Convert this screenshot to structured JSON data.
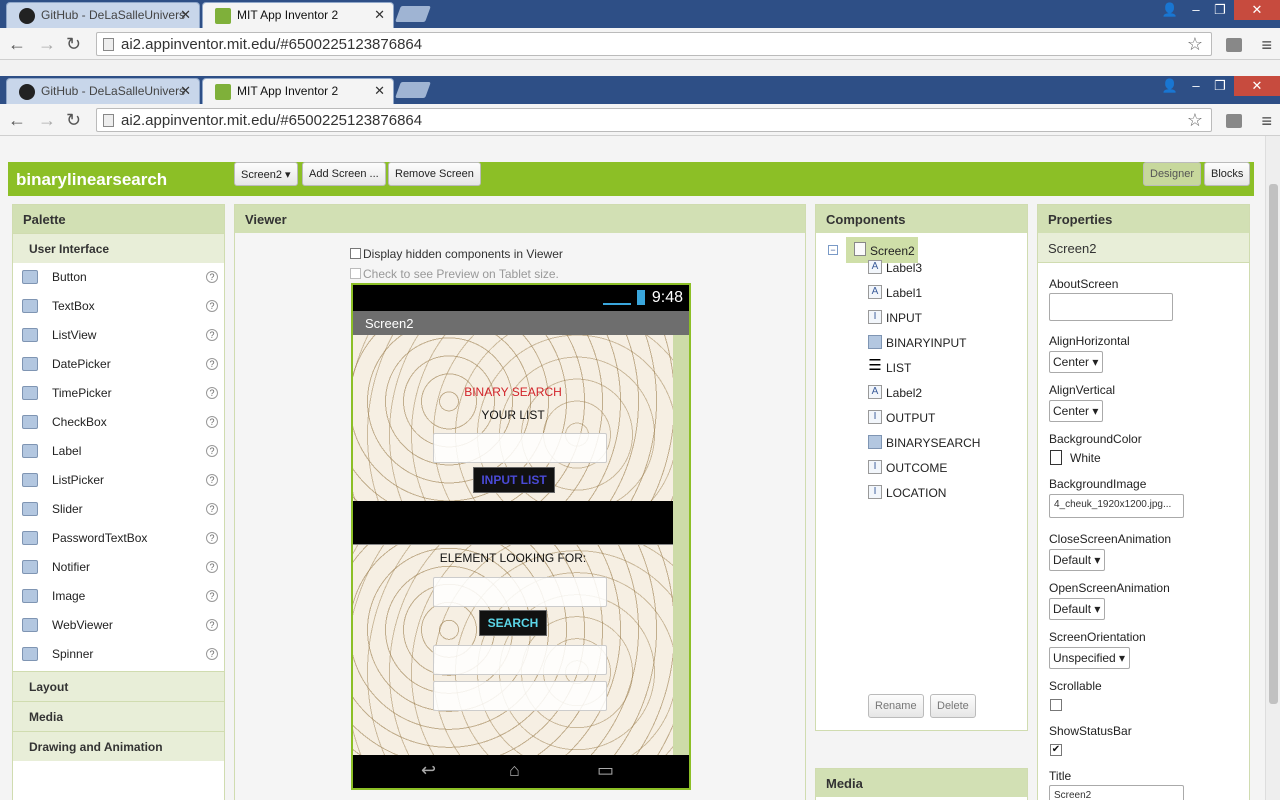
{
  "browser_back": {
    "tabs": [
      {
        "title": "GitHub - DeLaSalleUnivers"
      },
      {
        "title": "MIT App Inventor 2"
      }
    ],
    "url": "ai2.appinventor.mit.edu/#6500225123876864"
  },
  "browser_front": {
    "tabs": [
      {
        "title": "GitHub - DeLaSalleUnivers"
      },
      {
        "title": "MIT App Inventor 2"
      }
    ],
    "url": "ai2.appinventor.mit.edu/#6500225123876864"
  },
  "project": {
    "name": "binarylinearsearch",
    "screen_selector": "Screen2 ▾",
    "add_screen": "Add Screen ...",
    "remove_screen": "Remove Screen",
    "designer": "Designer",
    "blocks": "Blocks"
  },
  "palette": {
    "header": "Palette",
    "category_open": "User Interface",
    "items": [
      {
        "label": "Button",
        "icon": "button-icon"
      },
      {
        "label": "TextBox",
        "icon": "textbox-icon"
      },
      {
        "label": "ListView",
        "icon": "listview-icon"
      },
      {
        "label": "DatePicker",
        "icon": "datepicker-icon"
      },
      {
        "label": "TimePicker",
        "icon": "timepicker-icon"
      },
      {
        "label": "CheckBox",
        "icon": "checkbox-icon"
      },
      {
        "label": "Label",
        "icon": "label-icon"
      },
      {
        "label": "ListPicker",
        "icon": "listpicker-icon"
      },
      {
        "label": "Slider",
        "icon": "slider-icon"
      },
      {
        "label": "PasswordTextBox",
        "icon": "passwordtextbox-icon"
      },
      {
        "label": "Notifier",
        "icon": "notifier-icon"
      },
      {
        "label": "Image",
        "icon": "image-icon"
      },
      {
        "label": "WebViewer",
        "icon": "webviewer-icon"
      },
      {
        "label": "Spinner",
        "icon": "spinner-icon"
      }
    ],
    "help": "?",
    "categories": [
      "Layout",
      "Media",
      "Drawing and Animation"
    ]
  },
  "viewer": {
    "header": "Viewer",
    "show_hidden": "Display hidden components in Viewer",
    "tablet_preview": "Check to see Preview on Tablet size.",
    "phone": {
      "time": "9:48",
      "title": "Screen2",
      "binary_search": "BINARY SEARCH",
      "your_list": "YOUR LIST",
      "input_list": "INPUT LIST",
      "element_looking_for": "ELEMENT LOOKING FOR:",
      "search": "SEARCH"
    }
  },
  "components": {
    "header": "Components",
    "root": "Screen2",
    "items": [
      {
        "label": "Label3",
        "icon": "A"
      },
      {
        "label": "Label1",
        "icon": "A"
      },
      {
        "label": "INPUT",
        "icon": "I"
      },
      {
        "label": "BINARYINPUT",
        "icon": ""
      },
      {
        "label": "LIST",
        "icon": "☰"
      },
      {
        "label": "Label2",
        "icon": "A"
      },
      {
        "label": "OUTPUT",
        "icon": "I"
      },
      {
        "label": "BINARYSEARCH",
        "icon": ""
      },
      {
        "label": "OUTCOME",
        "icon": "I"
      },
      {
        "label": "LOCATION",
        "icon": "I"
      }
    ],
    "rename": "Rename",
    "delete": "Delete",
    "media_header": "Media"
  },
  "properties": {
    "header": "Properties",
    "component": "Screen2",
    "about_screen_label": "AboutScreen",
    "about_screen_value": "",
    "align_horizontal_label": "AlignHorizontal",
    "align_horizontal_value": "Center ▾",
    "align_vertical_label": "AlignVertical",
    "align_vertical_value": "Center ▾",
    "background_color_label": "BackgroundColor",
    "background_color_value": "White",
    "background_image_label": "BackgroundImage",
    "background_image_value": "4_cheuk_1920x1200.jpg...",
    "close_anim_label": "CloseScreenAnimation",
    "close_anim_value": "Default ▾",
    "open_anim_label": "OpenScreenAnimation",
    "open_anim_value": "Default ▾",
    "orientation_label": "ScreenOrientation",
    "orientation_value": "Unspecified ▾",
    "scrollable_label": "Scrollable",
    "show_status_bar_label": "ShowStatusBar",
    "title_label": "Title",
    "title_value": "Screen2"
  },
  "colors": {
    "accent_green": "#8cbf26",
    "panel_header": "#d2e0b4",
    "tabbar": "#2e4f86"
  }
}
